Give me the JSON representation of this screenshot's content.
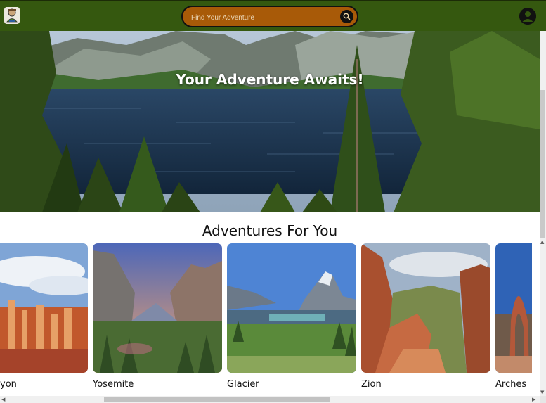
{
  "header": {
    "logo_icon": "hiker-logo-icon",
    "search": {
      "placeholder": "Find Your Adventure",
      "icon": "search-icon"
    },
    "account_icon": "user-account-icon",
    "colors": {
      "bar": "#35580f",
      "search_fill": "#a85a08"
    }
  },
  "hero": {
    "title": "Your Adventure Awaits!"
  },
  "adventures": {
    "title": "Adventures For You",
    "cards": [
      {
        "label": "Bryce Canyon",
        "visible_label": "yon"
      },
      {
        "label": "Yosemite",
        "visible_label": "Yosemite"
      },
      {
        "label": "Glacier",
        "visible_label": "Glacier"
      },
      {
        "label": "Zion",
        "visible_label": "Zion"
      },
      {
        "label": "Arches",
        "visible_label": "Arches"
      }
    ]
  }
}
